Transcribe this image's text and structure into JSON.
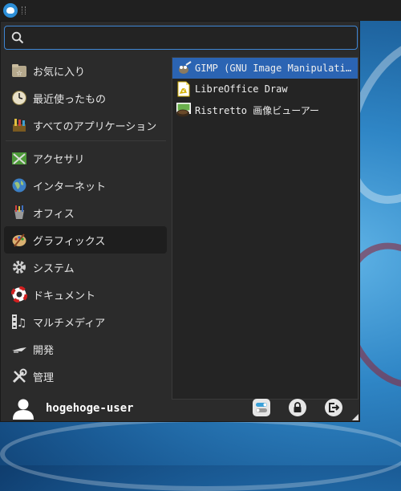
{
  "panel": {
    "logo_icon": "xfce-mouse-icon"
  },
  "search": {
    "value": "",
    "placeholder": ""
  },
  "categories": [
    {
      "label": "お気に入り",
      "icon": "favorites-icon"
    },
    {
      "label": "最近使ったもの",
      "icon": "recent-icon"
    },
    {
      "label": "すべてのアプリケーション",
      "icon": "all-apps-icon"
    },
    {
      "label": "アクセサリ",
      "icon": "accessories-icon"
    },
    {
      "label": "インターネット",
      "icon": "internet-icon"
    },
    {
      "label": "オフィス",
      "icon": "office-icon"
    },
    {
      "label": "グラフィックス",
      "icon": "graphics-icon",
      "active": true
    },
    {
      "label": "システム",
      "icon": "system-icon"
    },
    {
      "label": "ドキュメント",
      "icon": "help-icon"
    },
    {
      "label": "マルチメディア",
      "icon": "multimedia-icon"
    },
    {
      "label": "開発",
      "icon": "development-icon"
    },
    {
      "label": "管理",
      "icon": "settings-icon"
    }
  ],
  "apps": [
    {
      "label": "GIMP (GNU Image Manipulati…",
      "icon": "gimp-icon",
      "selected": true
    },
    {
      "label": "LibreOffice Draw",
      "icon": "libreoffice-draw-icon"
    },
    {
      "label": "Ristretto 画像ビューアー",
      "icon": "ristretto-icon"
    }
  ],
  "user": {
    "name": "hogehoge-user",
    "icon": "user-avatar-icon"
  },
  "actions": [
    {
      "name": "settings-toggle-button",
      "icon": "settings-manager-icon"
    },
    {
      "name": "lock-screen-button",
      "icon": "lock-icon"
    },
    {
      "name": "logout-button",
      "icon": "logout-icon"
    }
  ],
  "colors": {
    "accent": "#2b64b3",
    "search_border": "#3f86d4",
    "menu_bg": "#2b2b2b"
  }
}
